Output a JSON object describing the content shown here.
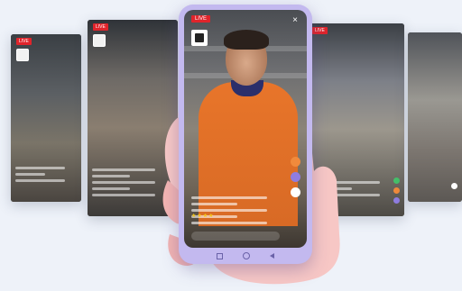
{
  "badge": {
    "live_label": "LIVE"
  },
  "close_glyph": "×",
  "rating_glyphs": "★★★★",
  "colors": {
    "background": "#eef2f9",
    "phone_frame": "#c3b9ef",
    "live_red": "#e0242b",
    "shirt_orange": "#e8752a",
    "heart_orange": "#f08a3c",
    "heart_purple": "#8f7de0",
    "heart_green": "#45c06a",
    "heart_white": "#ffffff"
  },
  "icons": [
    "close-icon",
    "heart-icon",
    "share-icon",
    "store-logo-icon",
    "home-icon",
    "back-icon",
    "recents-icon"
  ]
}
